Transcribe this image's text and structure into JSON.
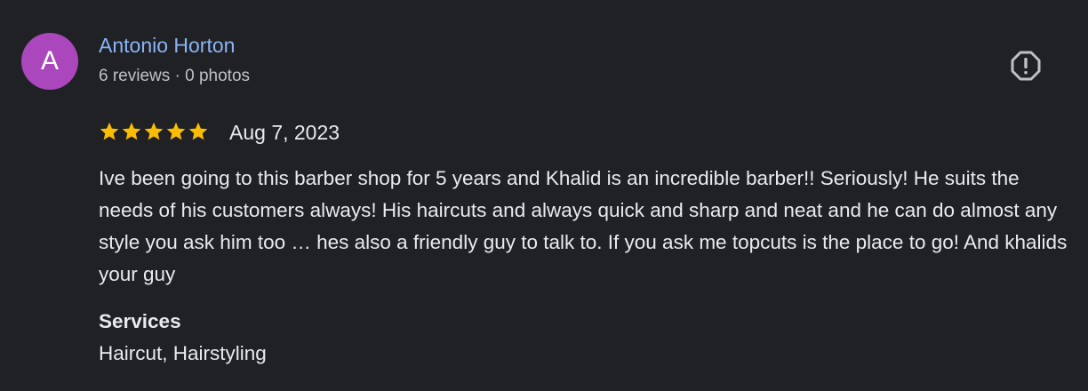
{
  "review": {
    "avatar_letter": "A",
    "avatar_color": "#ab47bc",
    "author_name": "Antonio Horton",
    "author_meta": "6 reviews · 0 photos",
    "report_icon": "report-flag-icon",
    "rating": 5,
    "rating_max": 5,
    "star_color": "#fbbc04",
    "date": "Aug 7, 2023",
    "text": "Ive been going to this barber shop for 5 years and Khalid is an incredible barber!! Seriously! He suits the needs of his customers always! His haircuts and always quick and sharp and neat and he can do almost any style you ask him too … hes also a friendly guy to talk to. If you ask me topcuts is the place to go! And khalids your guy",
    "services_label": "Services",
    "services_value": "Haircut, Hairstyling"
  }
}
